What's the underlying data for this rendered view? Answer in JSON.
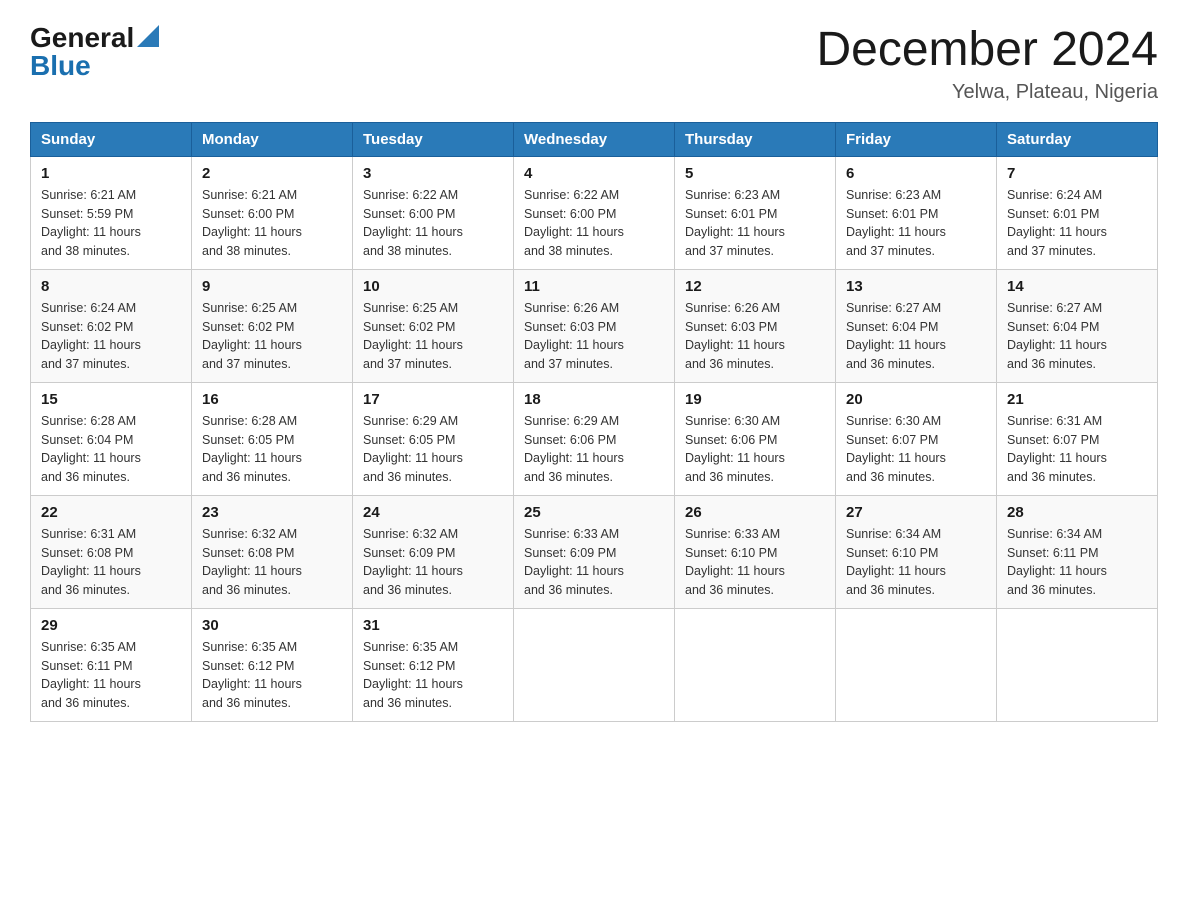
{
  "logo": {
    "general": "General",
    "blue": "Blue"
  },
  "title": {
    "month": "December 2024",
    "location": "Yelwa, Plateau, Nigeria"
  },
  "weekdays": [
    "Sunday",
    "Monday",
    "Tuesday",
    "Wednesday",
    "Thursday",
    "Friday",
    "Saturday"
  ],
  "weeks": [
    [
      {
        "day": "1",
        "sunrise": "6:21 AM",
        "sunset": "5:59 PM",
        "daylight": "11 hours and 38 minutes."
      },
      {
        "day": "2",
        "sunrise": "6:21 AM",
        "sunset": "6:00 PM",
        "daylight": "11 hours and 38 minutes."
      },
      {
        "day": "3",
        "sunrise": "6:22 AM",
        "sunset": "6:00 PM",
        "daylight": "11 hours and 38 minutes."
      },
      {
        "day": "4",
        "sunrise": "6:22 AM",
        "sunset": "6:00 PM",
        "daylight": "11 hours and 38 minutes."
      },
      {
        "day": "5",
        "sunrise": "6:23 AM",
        "sunset": "6:01 PM",
        "daylight": "11 hours and 37 minutes."
      },
      {
        "day": "6",
        "sunrise": "6:23 AM",
        "sunset": "6:01 PM",
        "daylight": "11 hours and 37 minutes."
      },
      {
        "day": "7",
        "sunrise": "6:24 AM",
        "sunset": "6:01 PM",
        "daylight": "11 hours and 37 minutes."
      }
    ],
    [
      {
        "day": "8",
        "sunrise": "6:24 AM",
        "sunset": "6:02 PM",
        "daylight": "11 hours and 37 minutes."
      },
      {
        "day": "9",
        "sunrise": "6:25 AM",
        "sunset": "6:02 PM",
        "daylight": "11 hours and 37 minutes."
      },
      {
        "day": "10",
        "sunrise": "6:25 AM",
        "sunset": "6:02 PM",
        "daylight": "11 hours and 37 minutes."
      },
      {
        "day": "11",
        "sunrise": "6:26 AM",
        "sunset": "6:03 PM",
        "daylight": "11 hours and 37 minutes."
      },
      {
        "day": "12",
        "sunrise": "6:26 AM",
        "sunset": "6:03 PM",
        "daylight": "11 hours and 36 minutes."
      },
      {
        "day": "13",
        "sunrise": "6:27 AM",
        "sunset": "6:04 PM",
        "daylight": "11 hours and 36 minutes."
      },
      {
        "day": "14",
        "sunrise": "6:27 AM",
        "sunset": "6:04 PM",
        "daylight": "11 hours and 36 minutes."
      }
    ],
    [
      {
        "day": "15",
        "sunrise": "6:28 AM",
        "sunset": "6:04 PM",
        "daylight": "11 hours and 36 minutes."
      },
      {
        "day": "16",
        "sunrise": "6:28 AM",
        "sunset": "6:05 PM",
        "daylight": "11 hours and 36 minutes."
      },
      {
        "day": "17",
        "sunrise": "6:29 AM",
        "sunset": "6:05 PM",
        "daylight": "11 hours and 36 minutes."
      },
      {
        "day": "18",
        "sunrise": "6:29 AM",
        "sunset": "6:06 PM",
        "daylight": "11 hours and 36 minutes."
      },
      {
        "day": "19",
        "sunrise": "6:30 AM",
        "sunset": "6:06 PM",
        "daylight": "11 hours and 36 minutes."
      },
      {
        "day": "20",
        "sunrise": "6:30 AM",
        "sunset": "6:07 PM",
        "daylight": "11 hours and 36 minutes."
      },
      {
        "day": "21",
        "sunrise": "6:31 AM",
        "sunset": "6:07 PM",
        "daylight": "11 hours and 36 minutes."
      }
    ],
    [
      {
        "day": "22",
        "sunrise": "6:31 AM",
        "sunset": "6:08 PM",
        "daylight": "11 hours and 36 minutes."
      },
      {
        "day": "23",
        "sunrise": "6:32 AM",
        "sunset": "6:08 PM",
        "daylight": "11 hours and 36 minutes."
      },
      {
        "day": "24",
        "sunrise": "6:32 AM",
        "sunset": "6:09 PM",
        "daylight": "11 hours and 36 minutes."
      },
      {
        "day": "25",
        "sunrise": "6:33 AM",
        "sunset": "6:09 PM",
        "daylight": "11 hours and 36 minutes."
      },
      {
        "day": "26",
        "sunrise": "6:33 AM",
        "sunset": "6:10 PM",
        "daylight": "11 hours and 36 minutes."
      },
      {
        "day": "27",
        "sunrise": "6:34 AM",
        "sunset": "6:10 PM",
        "daylight": "11 hours and 36 minutes."
      },
      {
        "day": "28",
        "sunrise": "6:34 AM",
        "sunset": "6:11 PM",
        "daylight": "11 hours and 36 minutes."
      }
    ],
    [
      {
        "day": "29",
        "sunrise": "6:35 AM",
        "sunset": "6:11 PM",
        "daylight": "11 hours and 36 minutes."
      },
      {
        "day": "30",
        "sunrise": "6:35 AM",
        "sunset": "6:12 PM",
        "daylight": "11 hours and 36 minutes."
      },
      {
        "day": "31",
        "sunrise": "6:35 AM",
        "sunset": "6:12 PM",
        "daylight": "11 hours and 36 minutes."
      },
      null,
      null,
      null,
      null
    ]
  ],
  "labels": {
    "sunrise": "Sunrise:",
    "sunset": "Sunset:",
    "daylight": "Daylight:"
  }
}
